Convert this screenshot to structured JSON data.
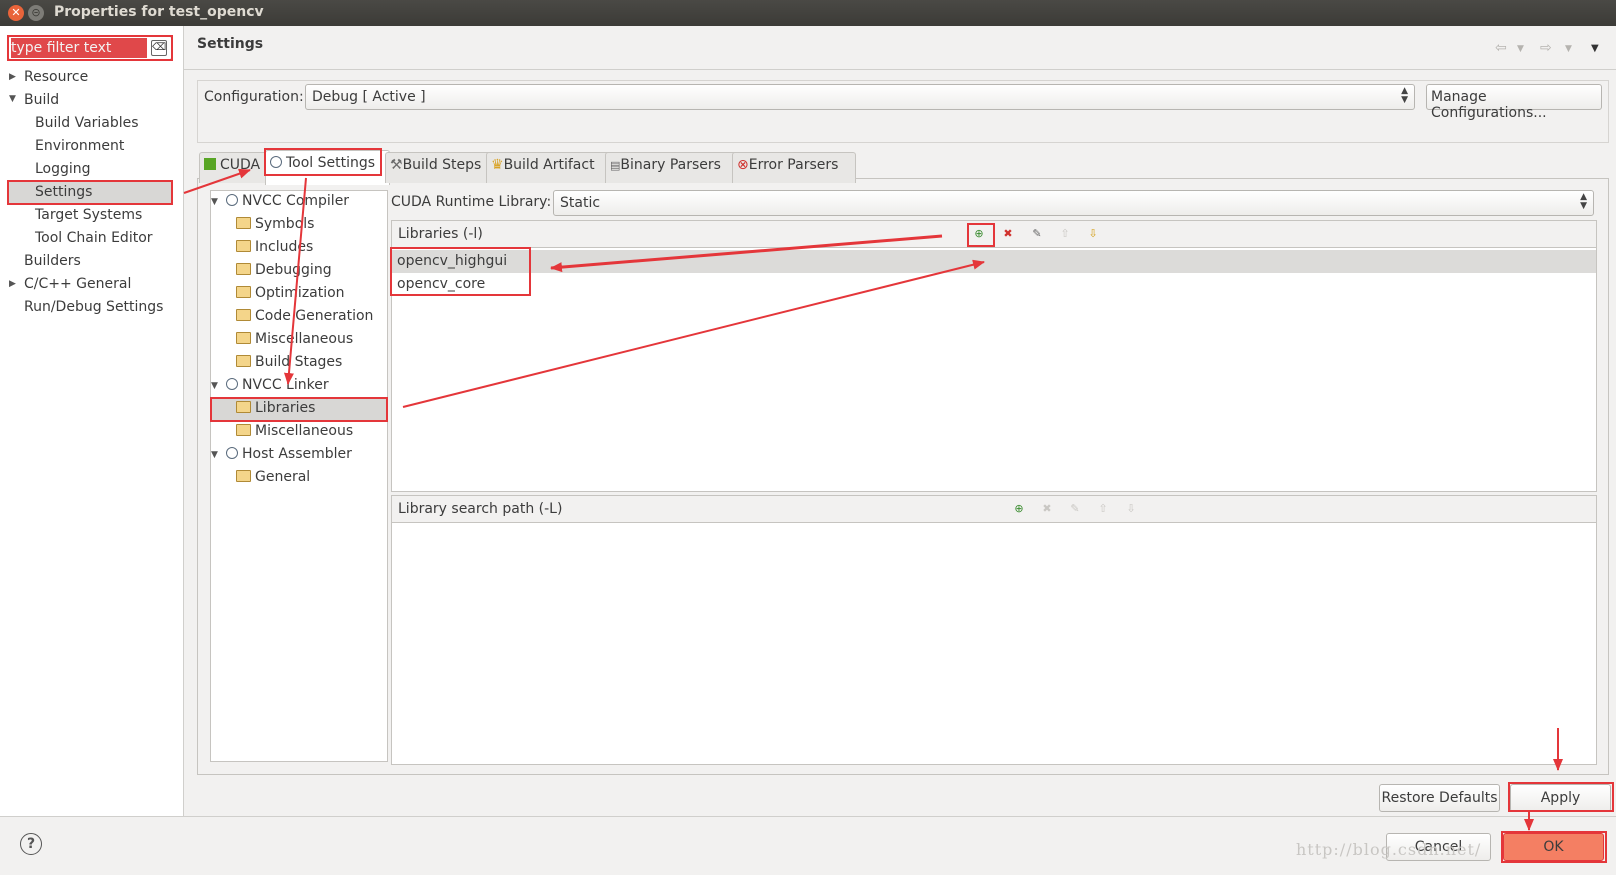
{
  "window": {
    "title": "Properties for test_opencv"
  },
  "filter": {
    "placeholder": "type filter text"
  },
  "left_tree": [
    {
      "label": "Resource"
    },
    {
      "label": "Build"
    },
    {
      "label": "Build Variables"
    },
    {
      "label": "Environment"
    },
    {
      "label": "Logging"
    },
    {
      "label": "Settings"
    },
    {
      "label": "Target Systems"
    },
    {
      "label": "Tool Chain Editor"
    },
    {
      "label": "Builders"
    },
    {
      "label": "C/C++ General"
    },
    {
      "label": "Run/Debug Settings"
    }
  ],
  "page": {
    "title": "Settings"
  },
  "configuration": {
    "label": "Configuration:",
    "value": "Debug  [ Active ]",
    "manage_label": "Manage Configurations..."
  },
  "tabs": [
    {
      "label": "CUDA"
    },
    {
      "label": "Tool Settings"
    },
    {
      "label": "Build Steps"
    },
    {
      "label": "Build Artifact"
    },
    {
      "label": "Binary Parsers"
    },
    {
      "label": "Error Parsers"
    }
  ],
  "tool_tree": [
    {
      "label": "NVCC Compiler"
    },
    {
      "label": "Symbols"
    },
    {
      "label": "Includes"
    },
    {
      "label": "Debugging"
    },
    {
      "label": "Optimization"
    },
    {
      "label": "Code Generation"
    },
    {
      "label": "Miscellaneous"
    },
    {
      "label": "Build Stages"
    },
    {
      "label": "NVCC Linker"
    },
    {
      "label": "Libraries"
    },
    {
      "label": "Miscellaneous"
    },
    {
      "label": "Host Assembler"
    },
    {
      "label": "General"
    }
  ],
  "runtime": {
    "label": "CUDA Runtime Library:",
    "value": "Static"
  },
  "libraries": {
    "title": "Libraries (-l)",
    "items": [
      "opencv_highgui",
      "opencv_core"
    ]
  },
  "libpath": {
    "title": "Library search path (-L)"
  },
  "buttons": {
    "restore": "Restore Defaults",
    "apply": "Apply",
    "cancel": "Cancel",
    "ok": "OK",
    "help": "?"
  },
  "watermark": "http://blog.csdn.net/",
  "colors": {
    "annotation": "#e4363a",
    "ok_highlight": "#f47f63"
  }
}
